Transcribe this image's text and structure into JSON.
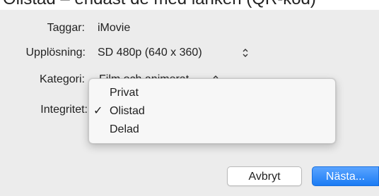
{
  "header_fragment": "Olistad – endast de med länken (QR-kod)",
  "form": {
    "tags": {
      "label": "Taggar:",
      "value": "iMovie"
    },
    "resolution": {
      "label": "Upplösning:",
      "value": "SD 480p (640 x 360)"
    },
    "category": {
      "label": "Kategori:",
      "value_obscured": "Film och animerat"
    },
    "privacy": {
      "label": "Integritet:"
    }
  },
  "privacy_menu": {
    "items": [
      {
        "label": "Privat",
        "checked": false
      },
      {
        "label": "Olistad",
        "checked": true
      },
      {
        "label": "Delad",
        "checked": false
      }
    ],
    "check_glyph": "✓"
  },
  "buttons": {
    "cancel": "Avbryt",
    "next": "Nästa..."
  },
  "colors": {
    "dialog_bg": "#ececec",
    "accent": "#1b7cf4"
  }
}
